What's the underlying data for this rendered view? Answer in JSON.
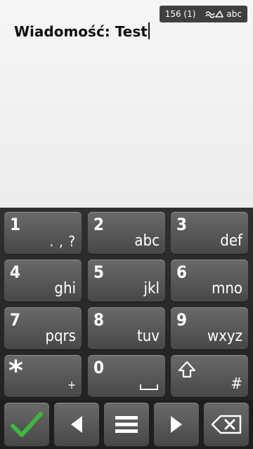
{
  "status": {
    "char_count": "156 (1)",
    "input_mode": "abc",
    "mode_icon": "predictive-text-icon"
  },
  "editor": {
    "message_text": "Wiadomość: Test"
  },
  "keypad": {
    "keys": [
      {
        "num": "1",
        "letters": ". , ?"
      },
      {
        "num": "2",
        "letters": "abc"
      },
      {
        "num": "3",
        "letters": "def"
      },
      {
        "num": "4",
        "letters": "ghi"
      },
      {
        "num": "5",
        "letters": "jkl"
      },
      {
        "num": "6",
        "letters": "mno"
      },
      {
        "num": "7",
        "letters": "pqrs"
      },
      {
        "num": "8",
        "letters": "tuv"
      },
      {
        "num": "9",
        "letters": "wxyz"
      },
      {
        "num": "*",
        "letters": "+"
      },
      {
        "num": "0",
        "letters": "",
        "icon": "space-icon"
      },
      {
        "num": "",
        "letters": "#",
        "icon": "shift-icon"
      }
    ]
  },
  "toolbar": {
    "buttons": [
      {
        "name": "confirm",
        "icon": "checkmark-icon",
        "color": "#3db83d"
      },
      {
        "name": "cursor-left",
        "icon": "arrow-left-icon"
      },
      {
        "name": "menu",
        "icon": "menu-icon"
      },
      {
        "name": "cursor-right",
        "icon": "arrow-right-icon"
      },
      {
        "name": "backspace",
        "icon": "backspace-icon"
      }
    ]
  }
}
